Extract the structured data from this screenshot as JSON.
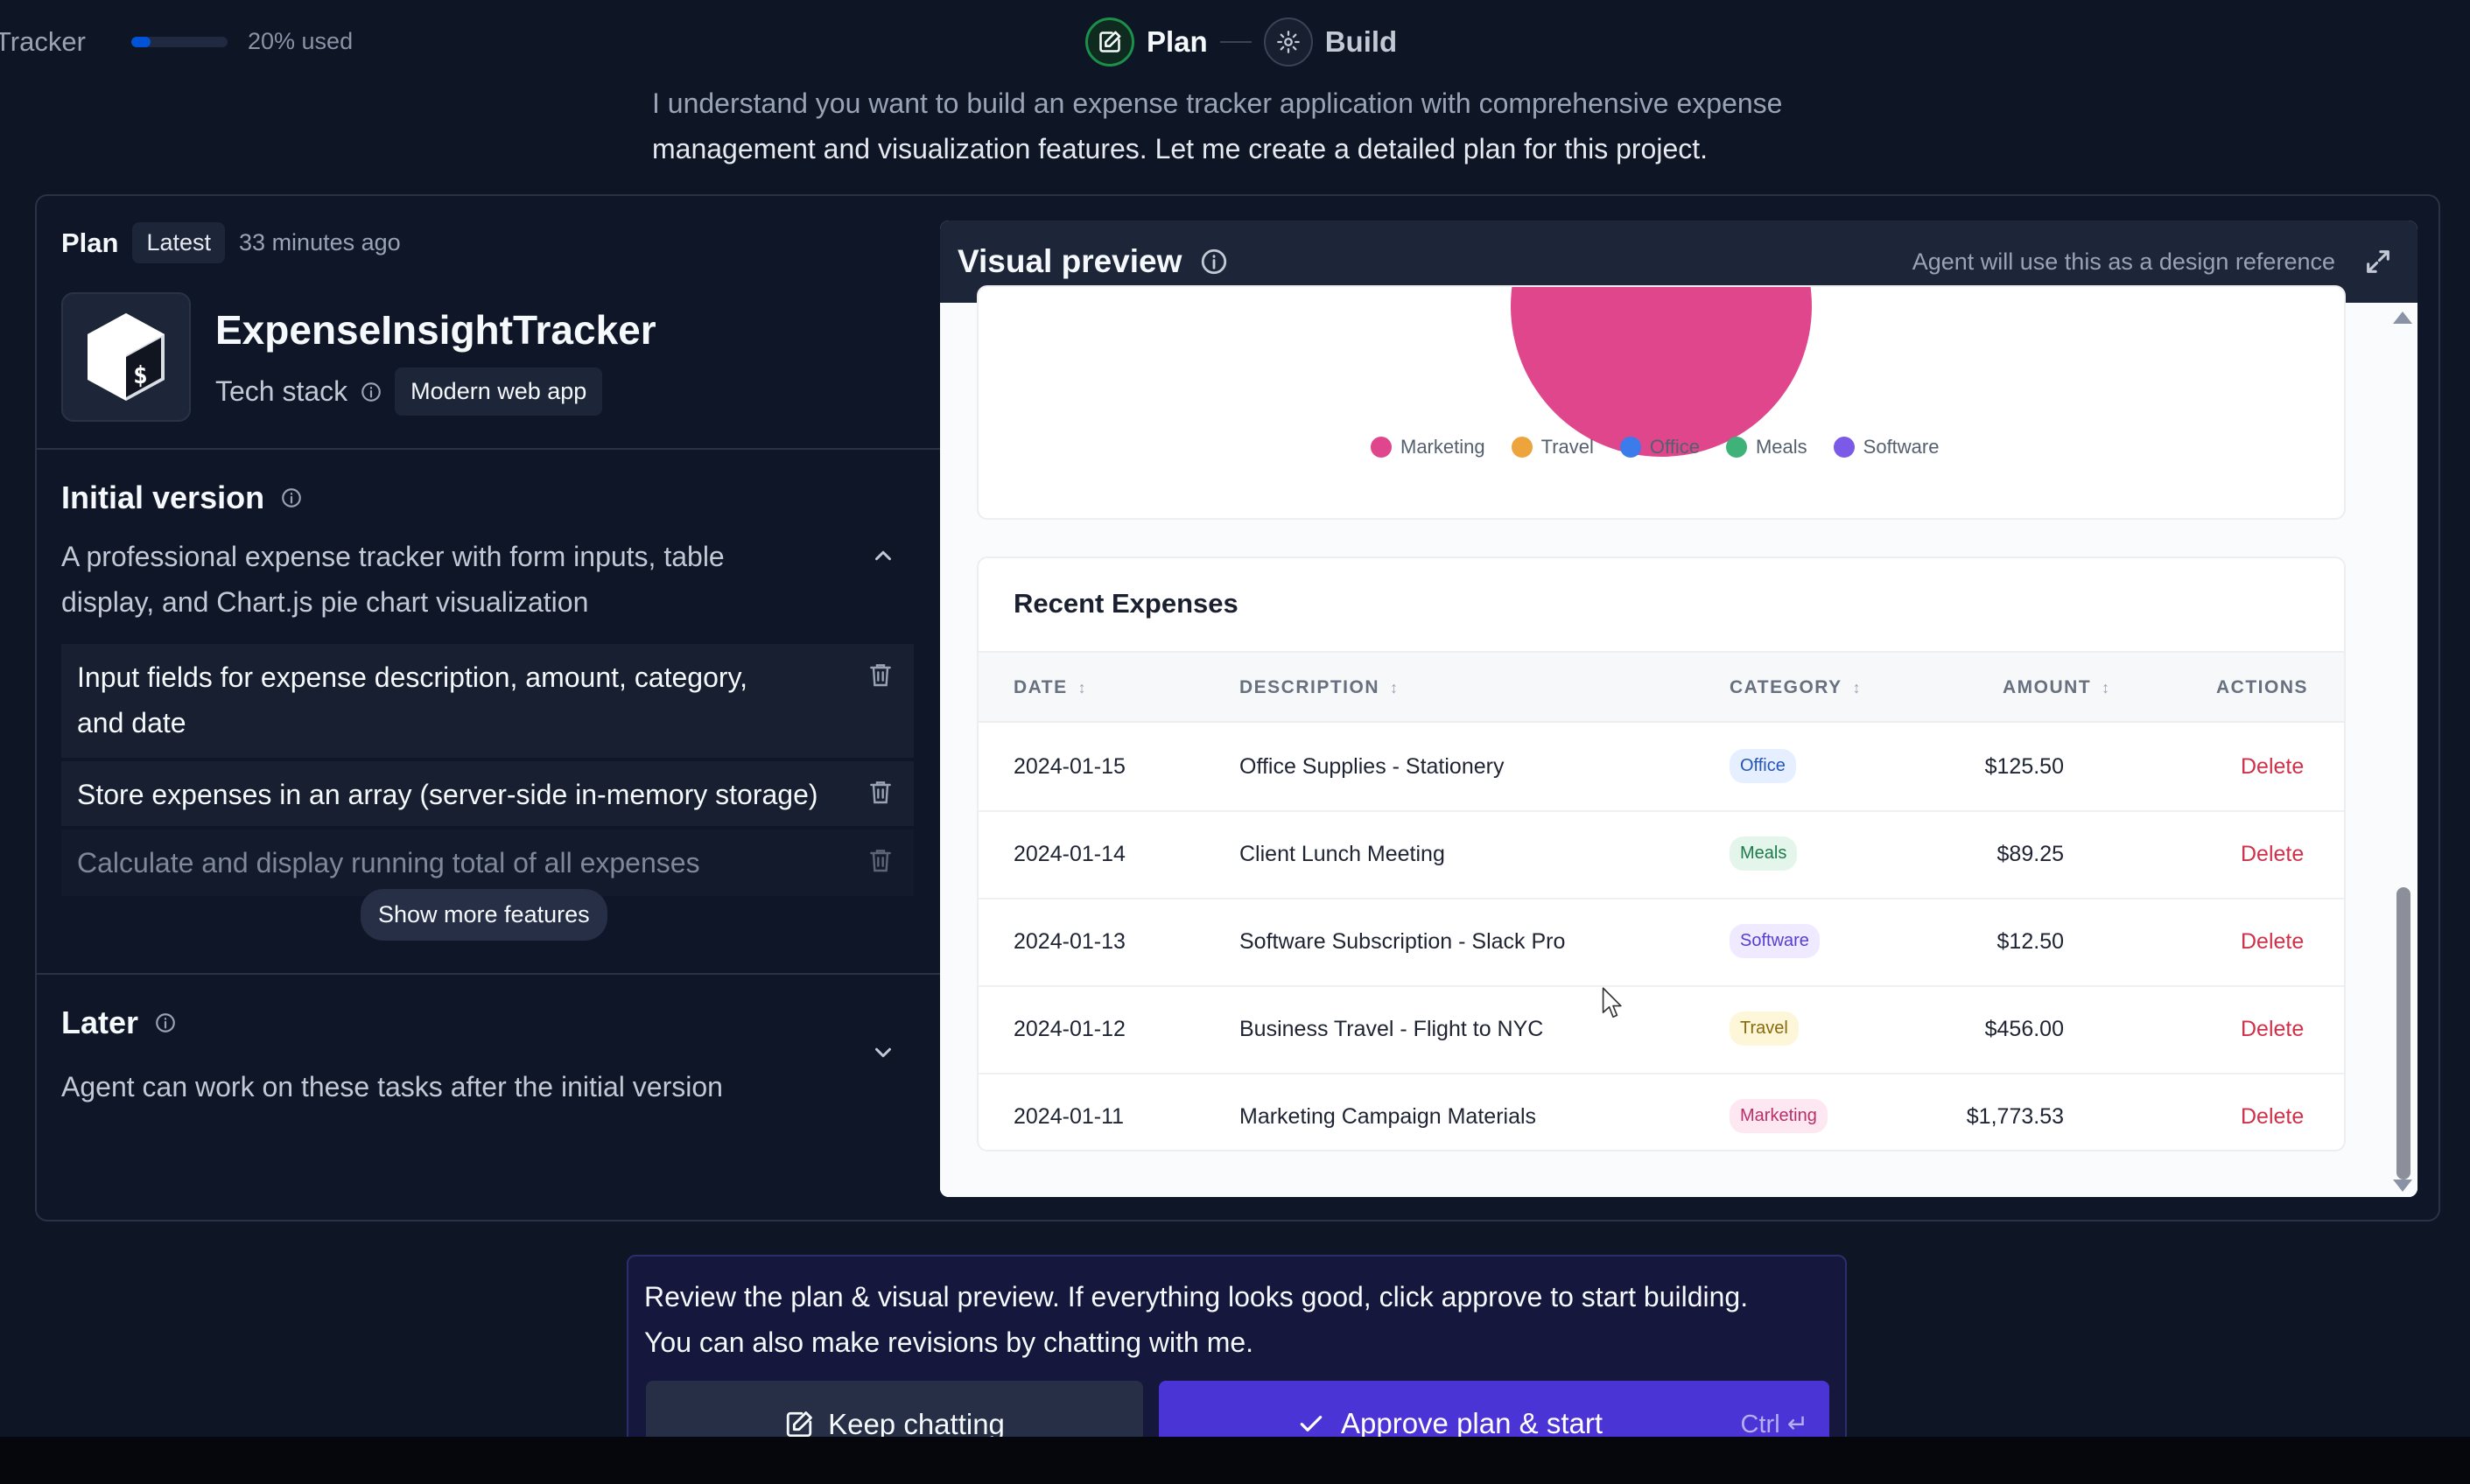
{
  "topbar": {
    "app_name": "Tracker",
    "usage_text": "20% used",
    "usage_fraction": 0.2,
    "steps": {
      "plan": "Plan",
      "build": "Build"
    }
  },
  "intro": {
    "line1": "I understand you want to build an expense tracker application with comprehensive expense",
    "line2": "management and visualization features. Let me create a detailed plan for this project."
  },
  "plan": {
    "title": "Plan",
    "badge": "Latest",
    "time": "33 minutes ago",
    "project_name": "ExpenseInsightTracker",
    "tech_label": "Tech stack",
    "tech_value": "Modern web app",
    "initial": {
      "title": "Initial version",
      "desc_line1": "A professional expense tracker with form inputs, table",
      "desc_line2": "display, and Chart.js pie chart visualization",
      "features": [
        {
          "line1": "Input fields for expense description, amount, category,",
          "line2": "and date"
        },
        {
          "line1": "Store expenses in an array (server-side in-memory storage)"
        },
        {
          "line1": "Calculate and display running total of all expenses"
        }
      ],
      "show_more": "Show more features"
    },
    "later": {
      "title": "Later",
      "desc": "Agent can work on these tasks after the initial version"
    }
  },
  "preview": {
    "title": "Visual preview",
    "note": "Agent will use this as a design reference",
    "legend": [
      {
        "label": "Marketing",
        "color": "#e0468c"
      },
      {
        "label": "Travel",
        "color": "#eea43c"
      },
      {
        "label": "Office",
        "color": "#3c7bea"
      },
      {
        "label": "Meals",
        "color": "#3fb27a"
      },
      {
        "label": "Software",
        "color": "#7a5ae6"
      }
    ],
    "table": {
      "title": "Recent Expenses",
      "headers": {
        "date": "DATE",
        "description": "DESCRIPTION",
        "category": "CATEGORY",
        "amount": "AMOUNT",
        "actions": "ACTIONS"
      },
      "sort_glyph": "↕",
      "rows": [
        {
          "date": "2024-01-15",
          "description": "Office Supplies - Stationery",
          "category": "Office",
          "amount": "$125.50",
          "action": "Delete"
        },
        {
          "date": "2024-01-14",
          "description": "Client Lunch Meeting",
          "category": "Meals",
          "amount": "$89.25",
          "action": "Delete"
        },
        {
          "date": "2024-01-13",
          "description": "Software Subscription - Slack Pro",
          "category": "Software",
          "amount": "$12.50",
          "action": "Delete"
        },
        {
          "date": "2024-01-12",
          "description": "Business Travel - Flight to NYC",
          "category": "Travel",
          "amount": "$456.00",
          "action": "Delete"
        },
        {
          "date": "2024-01-11",
          "description": "Marketing Campaign Materials",
          "category": "Marketing",
          "amount": "$1,773.53",
          "action": "Delete"
        }
      ]
    }
  },
  "prompt": {
    "line1": "Review the plan & visual preview. If everything looks good, click approve to start building.",
    "line2": "You can also make revisions by chatting with me.",
    "keep": "Keep chatting",
    "approve": "Approve plan & start",
    "shortcut": "Ctrl ↵"
  },
  "colors": {
    "background": "#0e1525",
    "accent": "#4b34d6",
    "plan_step": "#1c8f4a",
    "delete": "#d0314a"
  }
}
